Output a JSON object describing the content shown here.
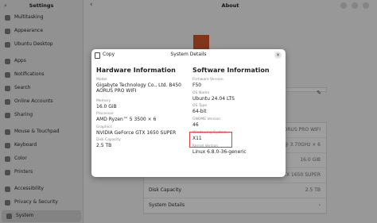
{
  "sidebar": {
    "title": "Settings",
    "items": [
      {
        "label": "Multitasking",
        "icon": "multitasking-icon"
      },
      {
        "label": "Appearance",
        "icon": "appearance-icon"
      },
      {
        "label": "Ubuntu Desktop",
        "icon": "desktop-icon"
      },
      {
        "label": "Apps",
        "icon": "apps-icon"
      },
      {
        "label": "Notifications",
        "icon": "bell-icon"
      },
      {
        "label": "Search",
        "icon": "search-icon"
      },
      {
        "label": "Online Accounts",
        "icon": "accounts-icon"
      },
      {
        "label": "Sharing",
        "icon": "share-icon"
      },
      {
        "label": "Mouse & Touchpad",
        "icon": "mouse-icon"
      },
      {
        "label": "Keyboard",
        "icon": "keyboard-icon"
      },
      {
        "label": "Color",
        "icon": "color-icon"
      },
      {
        "label": "Printers",
        "icon": "printer-icon"
      },
      {
        "label": "Accessibility",
        "icon": "accessibility-icon"
      },
      {
        "label": "Privacy & Security",
        "icon": "privacy-icon"
      },
      {
        "label": "System",
        "icon": "system-icon",
        "active": true
      }
    ]
  },
  "main": {
    "title": "About",
    "rows": [
      {
        "key": "",
        "value": "AORUS PRO WIFI"
      },
      {
        "key": "",
        "value": "PU @ 3.70GHz × 6"
      },
      {
        "key": "",
        "value": "16.0 GiB"
      },
      {
        "key": "",
        "value": "GTX 1650 SUPER"
      },
      {
        "key": "Disk Capacity",
        "value": "2.5 TB"
      },
      {
        "key": "System Details",
        "value": "›"
      }
    ]
  },
  "dialog": {
    "copy_label": "Copy",
    "title": "System Details",
    "close_glyph": "×",
    "hardware": {
      "heading": "Hardware Information",
      "fields": [
        {
          "label": "Model",
          "value": "Gigabyte Technology Co., Ltd. B450 AORUS PRO WIFI"
        },
        {
          "label": "Memory",
          "value": "16.0 GiB"
        },
        {
          "label": "Processor",
          "value": "AMD Ryzen™ 5 3500 × 6"
        },
        {
          "label": "Graphics",
          "value": "NVIDIA GeForce GTX 1650 SUPER"
        },
        {
          "label": "Disk Capacity",
          "value": "2.5 TB"
        }
      ]
    },
    "software": {
      "heading": "Software Information",
      "fields": [
        {
          "label": "Firmware Version",
          "value": "F50"
        },
        {
          "label": "OS Name",
          "value": "Ubuntu 24.04 LTS"
        },
        {
          "label": "OS Type",
          "value": "64-bit"
        },
        {
          "label": "GNOME Version",
          "value": "46"
        },
        {
          "label": "Windowing System",
          "value": "X11"
        },
        {
          "label": "Kernel Version",
          "value": "Linux 6.8.0-36-generic"
        }
      ]
    }
  },
  "colors": {
    "accent": "#d3562d",
    "highlight": "#e43c3c"
  }
}
